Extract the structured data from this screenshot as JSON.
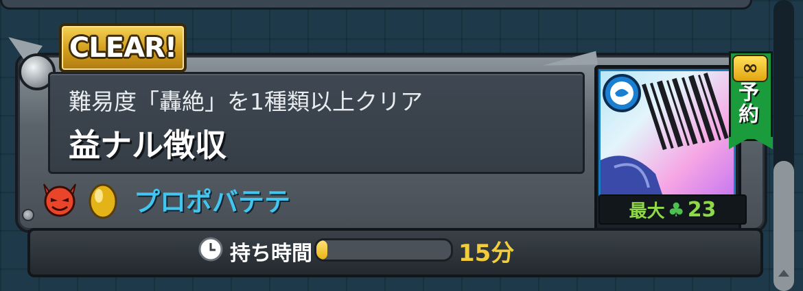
{
  "badge": {
    "label": "CLEAR!"
  },
  "quest": {
    "condition": "難易度「轟絶」を1種類以上クリア",
    "title": "益ナル徴収"
  },
  "reward": {
    "name": "プロポバテテ",
    "icons": [
      "devil-face-icon",
      "golden-egg-icon"
    ]
  },
  "timer": {
    "label": "持ち時間",
    "value": "15分",
    "progress": 0.08
  },
  "character": {
    "element_icon": "water-element-icon",
    "max_prefix": "最大",
    "max_icon": "clover-icon",
    "max_value": "23"
  },
  "ribbon": {
    "infinity": "∞",
    "label": "予約"
  },
  "colors": {
    "background": "#1e3a4a",
    "badge_gold": "#d39c1c",
    "reward_text": "#43c5ef",
    "time_value": "#f2cc3a",
    "ribbon_green": "#1a9c3c",
    "max_green": "#8fd948"
  }
}
